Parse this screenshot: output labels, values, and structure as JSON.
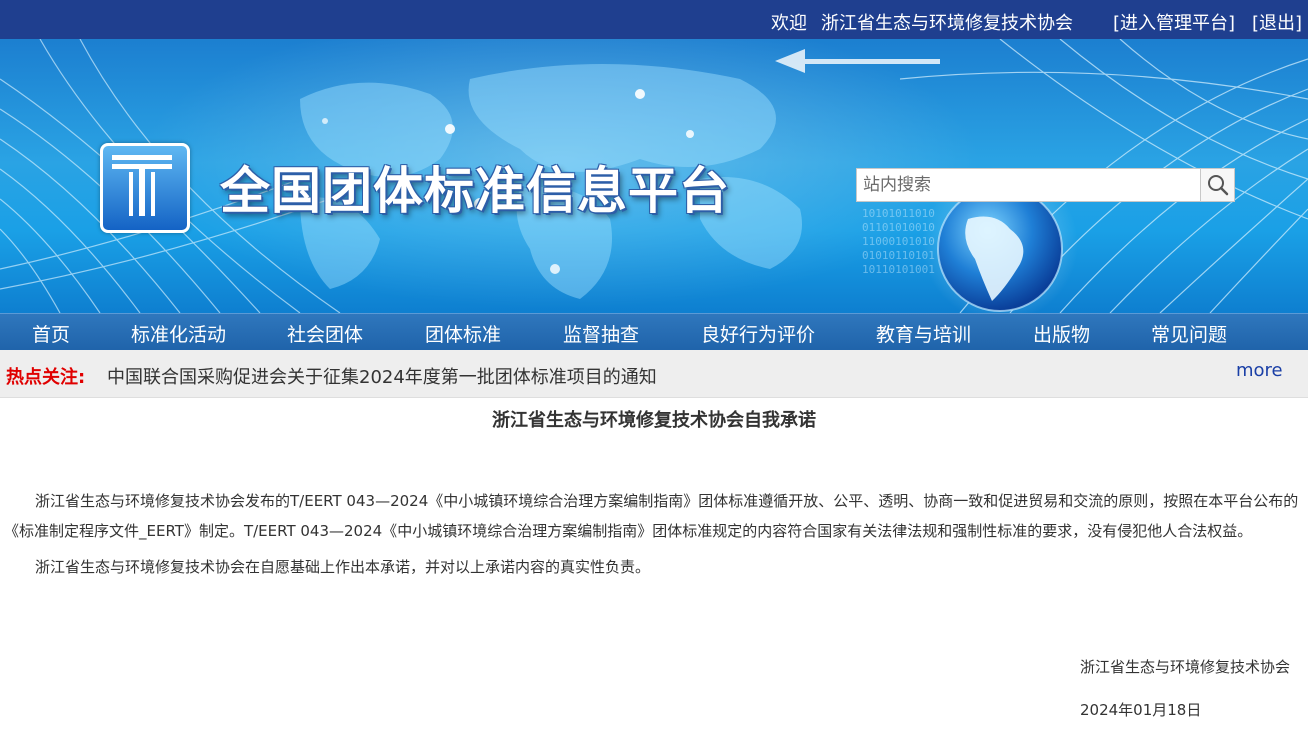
{
  "topbar": {
    "welcome": "欢迎",
    "org_name": "浙江省生态与环境修复技术协会",
    "admin_link": "[进入管理平台]",
    "logout_link": "[退出]"
  },
  "header": {
    "site_title": "全国团体标准信息平台",
    "search_placeholder": "站内搜索"
  },
  "nav": {
    "items": [
      "首页",
      "标准化活动",
      "社会团体",
      "团体标准",
      "监督抽查",
      "良好行为评价",
      "教育与培训",
      "出版物",
      "常见问题"
    ]
  },
  "hot": {
    "label": "热点关注:",
    "headline": "中国联合国采购促进会关于征集2024年度第一批团体标准项目的通知",
    "more": "more"
  },
  "article": {
    "title": "浙江省生态与环境修复技术协会自我承诺",
    "paragraphs": [
      "浙江省生态与环境修复技术协会发布的T/EERT 043—2024《中小城镇环境综合治理方案编制指南》团体标准遵循开放、公平、透明、协商一致和促进贸易和交流的原则，按照在本平台公布的《标准制定程序文件_EERT》制定。T/EERT 043—2024《中小城镇环境综合治理方案编制指南》团体标准规定的内容符合国家有关法律法规和强制性标准的要求，没有侵犯他人合法权益。",
      "浙江省生态与环境修复技术协会在自愿基础上作出本承诺，并对以上承诺内容的真实性负责。"
    ],
    "signature_org": "浙江省生态与环境修复技术协会",
    "signature_date": "2024年01月18日"
  },
  "colors": {
    "topbar_bg": "#1f3f8f",
    "nav_bg": "#2f77bd",
    "hot_label": "#e00000",
    "more_link": "#1a3fa6"
  }
}
